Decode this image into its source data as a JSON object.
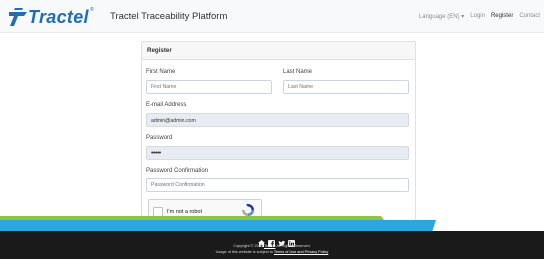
{
  "colors": {
    "brand": "#1f6db3",
    "footer_bg": "#1a1a1a",
    "stripe_blue": "#2ba6de",
    "stripe_green": "#8cc63f"
  },
  "header": {
    "logo_text": "Tractel",
    "logo_reg": "®",
    "title": "Tractel Traceability Platform",
    "nav": {
      "language": "Language (EN) ▾",
      "login": "Login",
      "register": "Register",
      "contact": "Contact"
    }
  },
  "form": {
    "heading": "Register",
    "first_name": {
      "label": "First Name",
      "placeholder": "First Name",
      "value": ""
    },
    "last_name": {
      "label": "Last Name",
      "placeholder": "Last Name",
      "value": ""
    },
    "email": {
      "label": "E-mail Address",
      "value": "admin@admin.com"
    },
    "password": {
      "label": "Password",
      "value": "•••••"
    },
    "password_confirmation": {
      "label": "Password Confirmation",
      "placeholder": "Password Confirmation",
      "value": ""
    },
    "captcha": {
      "label": "I'm not a robot",
      "icon": "recaptcha-icon"
    }
  },
  "footer": {
    "social_icons": [
      "home-icon",
      "facebook-icon",
      "twitter-icon",
      "linkedin-icon"
    ],
    "copyright_prefix": "Copyright © 2020",
    "copyright_link": "Tractel",
    "copyright_suffix": "All Rights Reserved.",
    "usage_prefix": "Usage of this website is subject to",
    "usage_link": "Terms of Use and Privacy Policy"
  }
}
